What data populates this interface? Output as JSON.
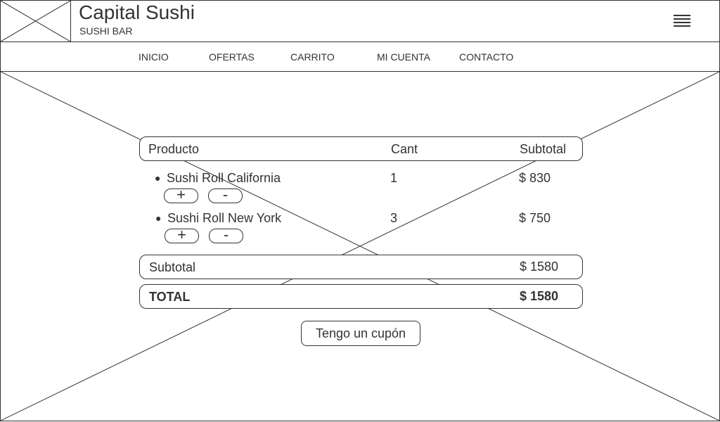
{
  "header": {
    "title": "Capital Sushi",
    "subtitle": "SUSHI BAR",
    "logo_icon": "image-placeholder-icon",
    "menu_icon": "hamburger-menu-icon"
  },
  "nav": {
    "items": [
      "INICIO",
      "OFERTAS",
      "CARRITO",
      "MI CUENTA",
      "CONTACTO"
    ]
  },
  "cart": {
    "columns": {
      "product": "Producto",
      "qty": "Cant",
      "subtotal": "Subtotal"
    },
    "items": [
      {
        "bullet": "●",
        "name": "Sushi Roll California",
        "qty": "1",
        "subtotal": "$ 830",
        "plus": "+",
        "minus": "-"
      },
      {
        "bullet": "●",
        "name": "Sushi Roll New York",
        "qty": "3",
        "subtotal": "$ 750",
        "plus": "+",
        "minus": "-"
      }
    ],
    "subtotal_label": "Subtotal",
    "subtotal_value": "$ 1580",
    "total_label": "TOTAL",
    "total_value": "$ 1580",
    "coupon_button": "Tengo un cupón"
  }
}
